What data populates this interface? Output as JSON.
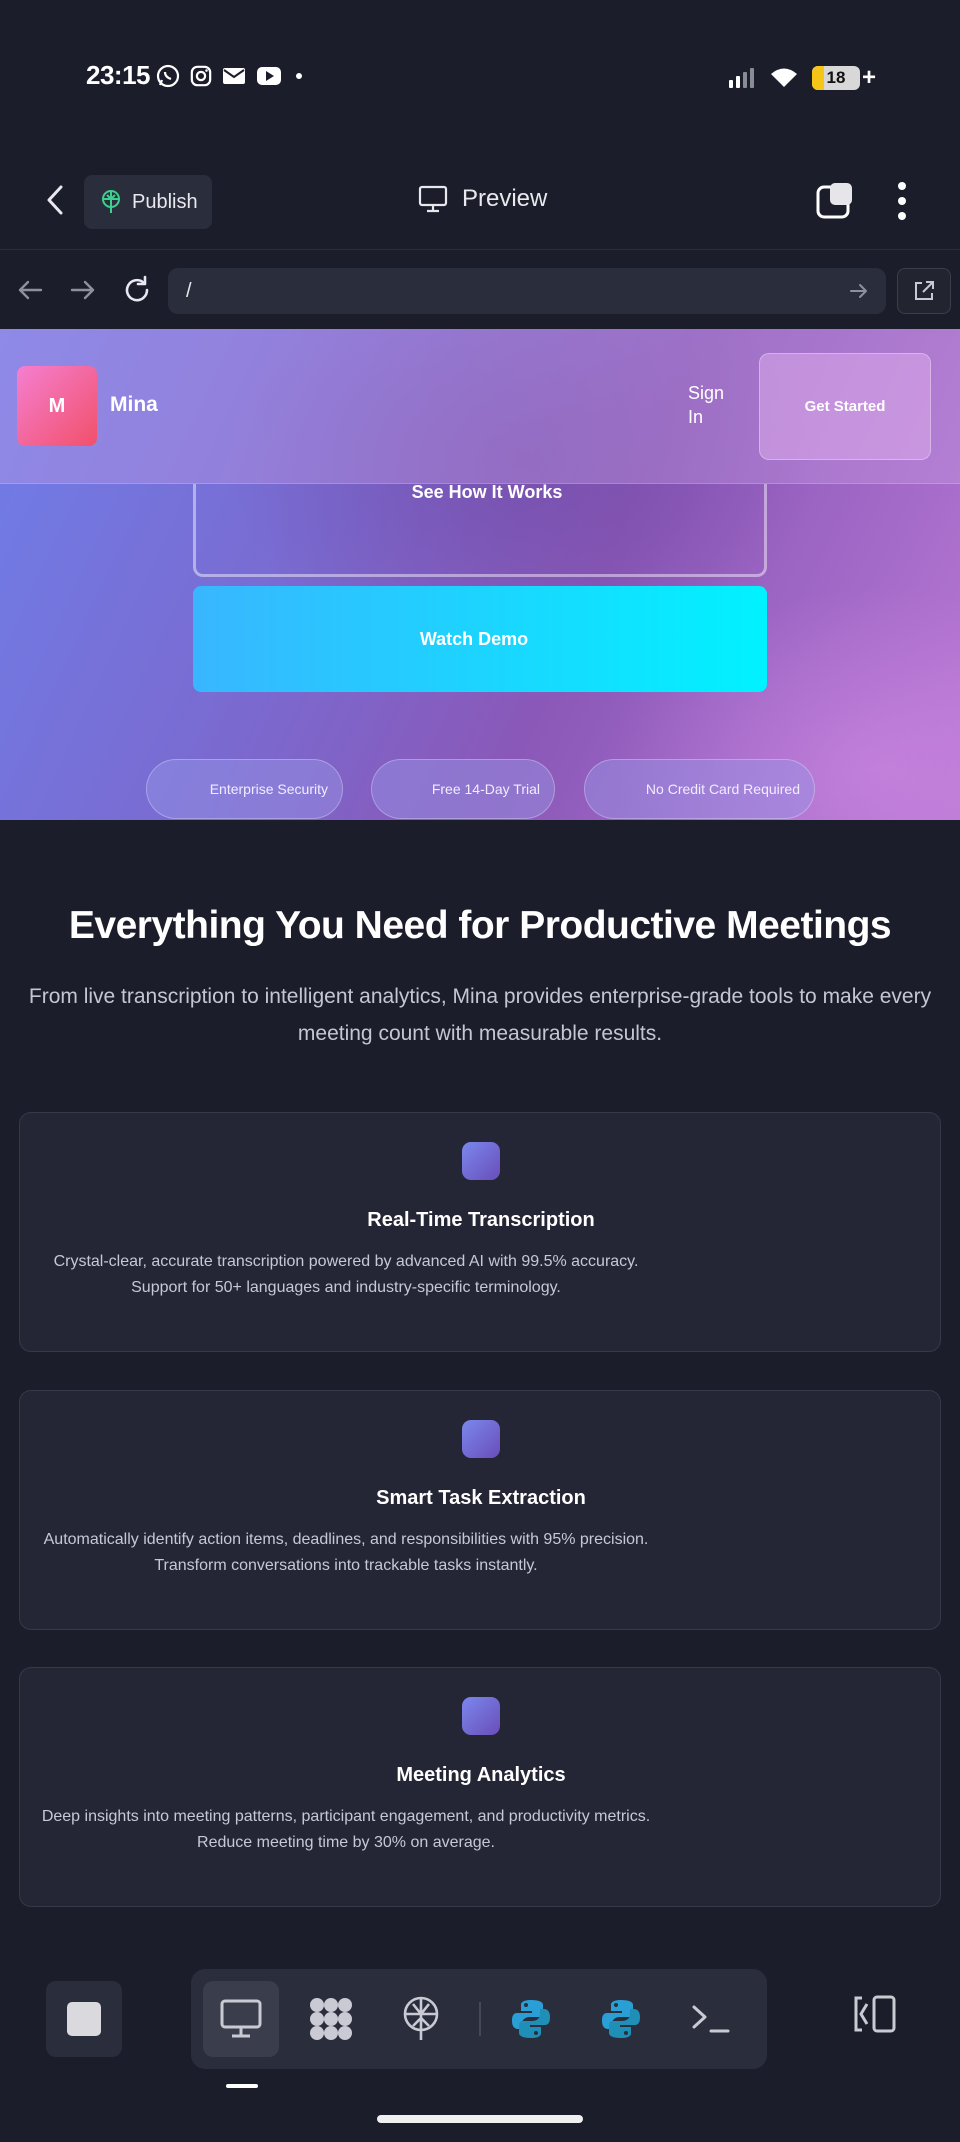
{
  "status_bar": {
    "time": "23:15",
    "notification_icons": [
      "whatsapp-icon",
      "instagram-icon",
      "mail-icon",
      "youtube-icon",
      "dot-icon"
    ],
    "battery_level": "18",
    "battery_charging": "+"
  },
  "app_bar": {
    "publish_label": "Publish",
    "preview_label": "Preview"
  },
  "browser": {
    "url": "/"
  },
  "site": {
    "logo_letter": "M",
    "brand": "Mina",
    "sign_in": "Sign In",
    "get_started": "Get Started",
    "see_how": "See How It Works",
    "watch_demo": "Watch Demo",
    "badges": [
      "Enterprise Security",
      "Free 14-Day Trial",
      "No Credit Card Required"
    ],
    "features_title": "Everything You Need for Productive Meetings",
    "features_subtitle": "From live transcription to intelligent analytics, Mina provides enterprise-grade tools to make every meeting count with measurable results.",
    "features": [
      {
        "title": "Real-Time Transcription",
        "description": "Crystal-clear, accurate transcription powered by advanced AI with 99.5% accuracy. Support for 50+ languages and industry-specific terminology."
      },
      {
        "title": "Smart Task Extraction",
        "description": "Automatically identify action items, deadlines, and responsibilities with 95% precision. Transform conversations into trackable tasks instantly."
      },
      {
        "title": "Meeting Analytics",
        "description": "Deep insights into meeting patterns, participant engagement, and productivity metrics. Reduce meeting time by 30% on average."
      }
    ]
  },
  "toolbar": {
    "tools": [
      "monitor-icon",
      "apps-grid-icon",
      "publish-icon",
      "python-icon",
      "python-icon",
      "terminal-icon"
    ],
    "active_tool": "monitor-icon"
  },
  "colors": {
    "background": "#1b1d2a",
    "card": "#242636",
    "accent_cyan": "#00f2ff",
    "hero_purple": "#8a58b8",
    "publish_green": "#3ecf8e"
  }
}
